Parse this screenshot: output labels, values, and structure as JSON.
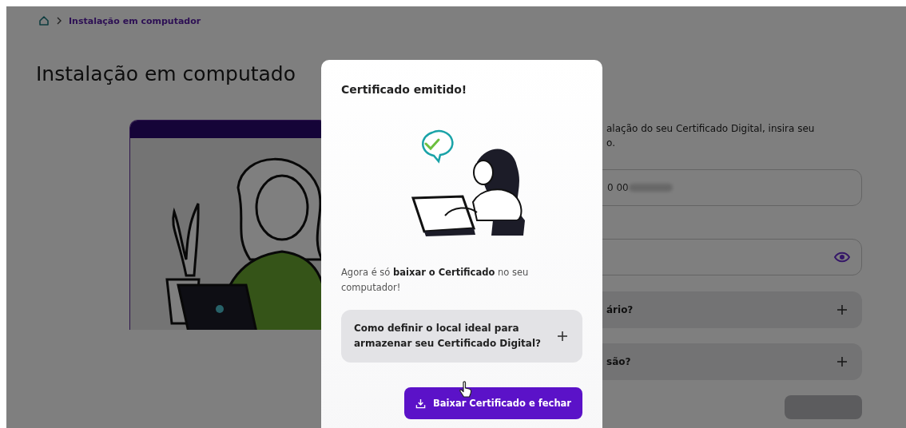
{
  "breadcrumb": {
    "current": "Instalação em computador"
  },
  "page_title": "Instalação em computado",
  "instruction_lines": [
    "alação do seu Certificado Digital, insira seu",
    "o."
  ],
  "fields": [
    {
      "kind": "text",
      "value": "0 00",
      "redacted": true
    },
    {
      "kind": "password"
    }
  ],
  "accordions": [
    {
      "question": "ário?",
      "expanded": false
    },
    {
      "question": "são?",
      "expanded": false
    }
  ],
  "modal": {
    "title": "Certificado emitido!",
    "message": "Agora é só **baixar o Certificado** no seu computador!",
    "accordion": {
      "question": "Como definir o local ideal para armazenar seu Certificado Digital?",
      "expanded": false
    },
    "button": {
      "label": "Baixar Certificado e fechar"
    }
  }
}
